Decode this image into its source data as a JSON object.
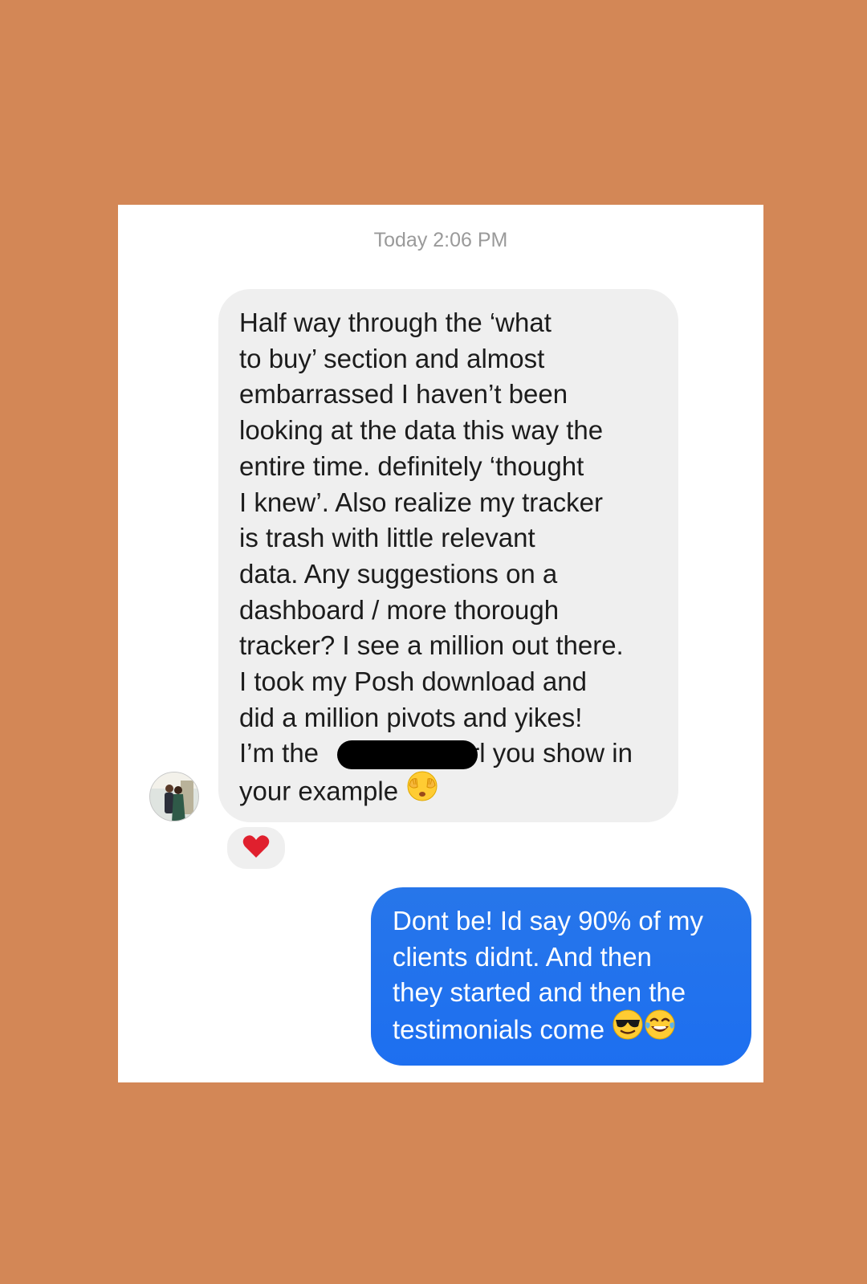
{
  "conversation": {
    "timestamp": "Today 2:06 PM",
    "incoming_message": {
      "lines": [
        "Half way through the ‘what",
        "to buy’ section and almost",
        "embarrassed I haven’t been",
        "looking at the data this way the",
        "entire time. definitely ‘thought",
        "I knew’. Also realize my tracker",
        "is trash with little relevant",
        "data. Any suggestions on a",
        "dashboard / more thorough",
        "tracker? I see a million out there.",
        "I took my Posh download and",
        "did a million pivots and yikes!",
        "I’m the ",
        "rl you show in",
        "your example "
      ],
      "emoji": "see-no-evil-smiley-icon",
      "reaction": "heart-icon",
      "reaction_color": "#e0202e"
    },
    "outgoing_message": {
      "lines": [
        "Dont be! Id say 90% of my",
        "clients didnt. And then",
        "they started and then the",
        "testimonials come "
      ],
      "emojis": [
        "sunglasses-face-icon",
        "tears-of-joy-face-icon"
      ],
      "bubble_color": "#2273EE"
    },
    "colors": {
      "background": "#D38756",
      "card": "#FFFFFF",
      "incoming_bubble": "#EFEFEF",
      "timestamp_text": "#9A9A9A"
    }
  }
}
